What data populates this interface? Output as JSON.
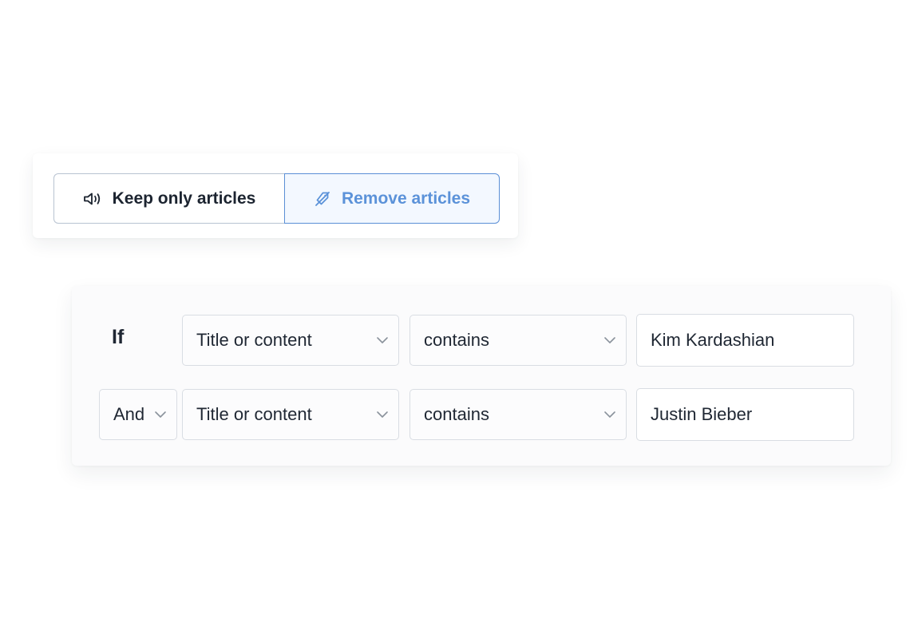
{
  "mode_toggle": {
    "keep_label": "Keep only articles",
    "keep_icon": "speaker-icon",
    "remove_label": "Remove articles",
    "remove_icon": "tag-off-icon",
    "selected": "remove"
  },
  "rules": {
    "if_label": "If",
    "rows": [
      {
        "field": "Title or content",
        "operator": "contains",
        "value": "Kim Kardashian"
      },
      {
        "connector": "And",
        "field": "Title or content",
        "operator": "contains",
        "value": "Justin Bieber"
      }
    ]
  },
  "colors": {
    "accent": "#5b92d9",
    "accent_bg": "#f3f8ff",
    "text": "#1f2733",
    "border": "#d9dde3"
  }
}
